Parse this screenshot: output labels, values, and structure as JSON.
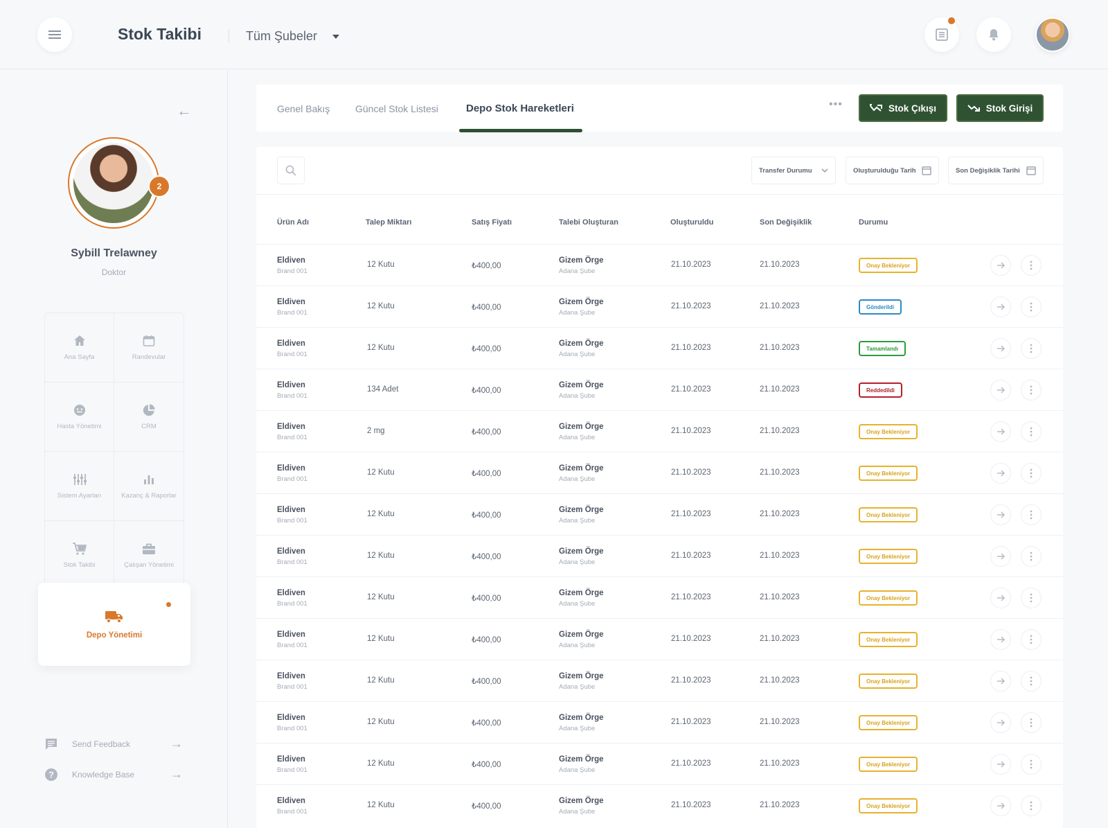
{
  "header": {
    "app_title": "Stok Takibi",
    "branch_selector": "Tüm Şubeler"
  },
  "profile": {
    "name": "Sybill Trelawney",
    "role": "Doktor",
    "badge_count": "2"
  },
  "sidebar": {
    "nav_items": [
      {
        "label": "Ana Sayfa",
        "icon": "home-icon"
      },
      {
        "label": "Randevular",
        "icon": "calendar-icon"
      },
      {
        "label": "Hasta Yönetimi",
        "icon": "patient-icon"
      },
      {
        "label": "CRM",
        "icon": "pie-chart-icon"
      },
      {
        "label": "Sistem Ayarları",
        "icon": "sliders-icon"
      },
      {
        "label": "Kazanç & Raporlar",
        "icon": "bar-chart-icon"
      },
      {
        "label": "Stok Takibi",
        "icon": "cart-icon"
      },
      {
        "label": "Çalışan Yönetimi",
        "icon": "briefcase-icon"
      }
    ],
    "active_item": {
      "label": "Depo Yönetimi",
      "icon": "truck-icon"
    },
    "links": [
      {
        "label": "Send Feedback",
        "icon": "feedback-icon"
      },
      {
        "label": "Knowledge Base",
        "icon": "help-icon"
      }
    ]
  },
  "tabs": {
    "items": [
      "Genel Bakış",
      "Güncel Stok Listesi",
      "Depo Stok Hareketleri"
    ],
    "active": "Depo Stok Hareketleri"
  },
  "actions": {
    "stock_out": "Stok Çıkışı",
    "stock_in": "Stok Girişi"
  },
  "filters": {
    "transfer_status": "Transfer Durumu",
    "created_date": "Oluşturulduğu Tarih",
    "modified_date": "Son Değişiklik Tarihi"
  },
  "table": {
    "columns": [
      "Ürün Adı",
      "Talep Miktarı",
      "Satış Fiyatı",
      "Talebi Oluşturan",
      "Oluşturuldu",
      "Son Değişiklik",
      "Durumu"
    ],
    "rows": [
      {
        "product": "Eldiven",
        "brand": "Brand 001",
        "qty": "12 Kutu",
        "price": "₺400,00",
        "user": "Gizem Örge",
        "branch": "Adana Şube",
        "created": "21.10.2023",
        "modified": "21.10.2023",
        "status": "Onay Bekleniyor",
        "status_type": "pending"
      },
      {
        "product": "Eldiven",
        "brand": "Brand 001",
        "qty": "12 Kutu",
        "price": "₺400,00",
        "user": "Gizem Örge",
        "branch": "Adana Şube",
        "created": "21.10.2023",
        "modified": "21.10.2023",
        "status": "Gönderildi",
        "status_type": "sent"
      },
      {
        "product": "Eldiven",
        "brand": "Brand 001",
        "qty": "12 Kutu",
        "price": "₺400,00",
        "user": "Gizem Örge",
        "branch": "Adana Şube",
        "created": "21.10.2023",
        "modified": "21.10.2023",
        "status": "Tamamlandı",
        "status_type": "done"
      },
      {
        "product": "Eldiven",
        "brand": "Brand 001",
        "qty": "134 Adet",
        "price": "₺400,00",
        "user": "Gizem Örge",
        "branch": "Adana Şube",
        "created": "21.10.2023",
        "modified": "21.10.2023",
        "status": "Reddedildi",
        "status_type": "rejected"
      },
      {
        "product": "Eldiven",
        "brand": "Brand 001",
        "qty": "2 mg",
        "price": "₺400,00",
        "user": "Gizem Örge",
        "branch": "Adana Şube",
        "created": "21.10.2023",
        "modified": "21.10.2023",
        "status": "Onay Bekleniyor",
        "status_type": "pending"
      },
      {
        "product": "Eldiven",
        "brand": "Brand 001",
        "qty": "12 Kutu",
        "price": "₺400,00",
        "user": "Gizem Örge",
        "branch": "Adana Şube",
        "created": "21.10.2023",
        "modified": "21.10.2023",
        "status": "Onay Bekleniyor",
        "status_type": "pending"
      },
      {
        "product": "Eldiven",
        "brand": "Brand 001",
        "qty": "12 Kutu",
        "price": "₺400,00",
        "user": "Gizem Örge",
        "branch": "Adana Şube",
        "created": "21.10.2023",
        "modified": "21.10.2023",
        "status": "Onay Bekleniyor",
        "status_type": "pending"
      },
      {
        "product": "Eldiven",
        "brand": "Brand 001",
        "qty": "12 Kutu",
        "price": "₺400,00",
        "user": "Gizem Örge",
        "branch": "Adana Şube",
        "created": "21.10.2023",
        "modified": "21.10.2023",
        "status": "Onay Bekleniyor",
        "status_type": "pending"
      },
      {
        "product": "Eldiven",
        "brand": "Brand 001",
        "qty": "12 Kutu",
        "price": "₺400,00",
        "user": "Gizem Örge",
        "branch": "Adana Şube",
        "created": "21.10.2023",
        "modified": "21.10.2023",
        "status": "Onay Bekleniyor",
        "status_type": "pending"
      },
      {
        "product": "Eldiven",
        "brand": "Brand 001",
        "qty": "12 Kutu",
        "price": "₺400,00",
        "user": "Gizem Örge",
        "branch": "Adana Şube",
        "created": "21.10.2023",
        "modified": "21.10.2023",
        "status": "Onay Bekleniyor",
        "status_type": "pending"
      },
      {
        "product": "Eldiven",
        "brand": "Brand 001",
        "qty": "12 Kutu",
        "price": "₺400,00",
        "user": "Gizem Örge",
        "branch": "Adana Şube",
        "created": "21.10.2023",
        "modified": "21.10.2023",
        "status": "Onay Bekleniyor",
        "status_type": "pending"
      },
      {
        "product": "Eldiven",
        "brand": "Brand 001",
        "qty": "12 Kutu",
        "price": "₺400,00",
        "user": "Gizem Örge",
        "branch": "Adana Şube",
        "created": "21.10.2023",
        "modified": "21.10.2023",
        "status": "Onay Bekleniyor",
        "status_type": "pending"
      },
      {
        "product": "Eldiven",
        "brand": "Brand 001",
        "qty": "12 Kutu",
        "price": "₺400,00",
        "user": "Gizem Örge",
        "branch": "Adana Şube",
        "created": "21.10.2023",
        "modified": "21.10.2023",
        "status": "Onay Bekleniyor",
        "status_type": "pending"
      },
      {
        "product": "Eldiven",
        "brand": "Brand 001",
        "qty": "12 Kutu",
        "price": "₺400,00",
        "user": "Gizem Örge",
        "branch": "Adana Şube",
        "created": "21.10.2023",
        "modified": "21.10.2023",
        "status": "Onay Bekleniyor",
        "status_type": "pending"
      }
    ]
  },
  "colors": {
    "accent": "#d9782b",
    "primary_green": "#2f5233",
    "pending": "#e7b22b",
    "sent": "#2a8ac6",
    "done": "#2c9b3d",
    "rejected": "#b3202a"
  }
}
